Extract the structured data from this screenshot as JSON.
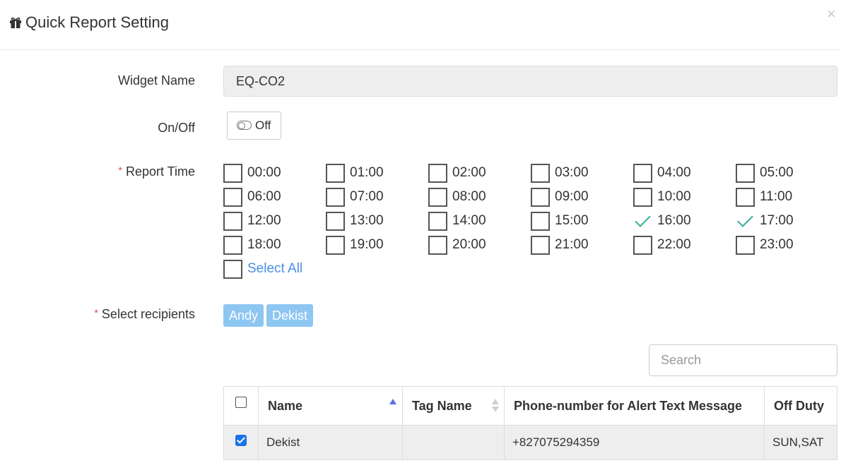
{
  "header": {
    "icon": "gift-icon",
    "title": "Quick Report Setting",
    "close_glyph": "×"
  },
  "form": {
    "widget_name_label": "Widget Name",
    "widget_name_value": "EQ-CO2",
    "onoff_label": "On/Off",
    "toggle_text": "Off",
    "required_mark": "*",
    "report_time_label": "Report Time",
    "select_recipients_label": "Select recipients"
  },
  "report_times": [
    {
      "label": "00:00",
      "checked": false
    },
    {
      "label": "01:00",
      "checked": false
    },
    {
      "label": "02:00",
      "checked": false
    },
    {
      "label": "03:00",
      "checked": false
    },
    {
      "label": "04:00",
      "checked": false
    },
    {
      "label": "05:00",
      "checked": false
    },
    {
      "label": "06:00",
      "checked": false
    },
    {
      "label": "07:00",
      "checked": false
    },
    {
      "label": "08:00",
      "checked": false
    },
    {
      "label": "09:00",
      "checked": false
    },
    {
      "label": "10:00",
      "checked": false
    },
    {
      "label": "11:00",
      "checked": false
    },
    {
      "label": "12:00",
      "checked": false
    },
    {
      "label": "13:00",
      "checked": false
    },
    {
      "label": "14:00",
      "checked": false
    },
    {
      "label": "15:00",
      "checked": false
    },
    {
      "label": "16:00",
      "checked": true
    },
    {
      "label": "17:00",
      "checked": true
    },
    {
      "label": "18:00",
      "checked": false
    },
    {
      "label": "19:00",
      "checked": false
    },
    {
      "label": "20:00",
      "checked": false
    },
    {
      "label": "21:00",
      "checked": false
    },
    {
      "label": "22:00",
      "checked": false
    },
    {
      "label": "23:00",
      "checked": false
    }
  ],
  "select_all": {
    "label": "Select All",
    "checked": false
  },
  "recipients": [
    "Andy",
    "Dekist"
  ],
  "search": {
    "placeholder": "Search",
    "value": ""
  },
  "table": {
    "headers": [
      "Name",
      "Tag Name",
      "Phone-number for Alert Text Message",
      "Off Duty"
    ],
    "rows": [
      {
        "checked": true,
        "name": "Dekist",
        "tag": "",
        "phone": "+827075294359",
        "off_duty": "SUN,SAT"
      }
    ]
  }
}
